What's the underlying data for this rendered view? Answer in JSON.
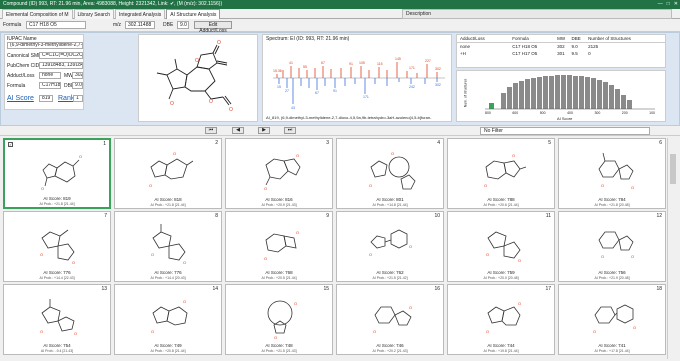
{
  "window": {
    "title": "Compound (ID) 993, RT: 21.96 min, Area: 4983088, Height: 2321342, Link: ✔, (M (m/z): 302.1156))"
  },
  "tabs": [
    {
      "label": "Elemental Composition of M"
    },
    {
      "label": "Library Search"
    },
    {
      "label": "Integrated Analysis"
    },
    {
      "label": "AI Structure Analysis"
    }
  ],
  "description_tab": "Description",
  "formula_bar": {
    "formula_label": "Formula",
    "formula": "C17 H18 O5",
    "mz_label": "m/z",
    "mz": "302.11488",
    "dbe_label": "DBE",
    "dbe": "9.0",
    "edit_button": "Edit Adduct/Loss"
  },
  "details": {
    "iupac_label": "IUPAC Name",
    "iupac": "(6,9-dimethyl-3-methylidene-2,7-dioxo-4,5,9a,9b-tetrahydro-3aH-az",
    "smiles_label": "Canonical SMILES",
    "smiles": "C=C1C(=O)OC2C3C(C)=CC(=O)C3(C)C(OC(C)=O)CC12",
    "pubchem_label": "PubChem CID",
    "pubchem": "13918483, 13918484",
    "adduct_label": "Adduct/Loss",
    "adduct": "none",
    "mw_label": "MW",
    "mw": "302",
    "formula_label": "Formula",
    "formula": "C17H18O5",
    "dbe_label": "DBE",
    "dbe": "9.0",
    "ai_score_label": "AI Score",
    "ai_score": "819",
    "rank_label": "Rank",
    "rank": "1"
  },
  "spectrum": {
    "title": "Spectrum: EI (ID: 993, RT: 21.96 min)",
    "caption": "AI_819, (6,9-dimethyl-3-methylidene-2,7-dioxo-4,5,9a,9b-tetrahydro-3aH-azuleno[4,5-b]furan-",
    "top_labels": [
      "15.36",
      "41",
      "55",
      "67",
      "77",
      "91",
      "105",
      "115",
      "130",
      "145",
      "159",
      "171",
      "189",
      "199",
      "214",
      "227",
      "242",
      "260",
      "284",
      "302"
    ],
    "bottom_labels": [
      "15",
      "27",
      "41",
      "43",
      "55",
      "67",
      "77",
      "91",
      "105",
      "115",
      "128",
      "145",
      "171",
      "187",
      "199",
      "242",
      "284",
      "302"
    ],
    "bottom_peak": "43"
  },
  "adduct_table": {
    "headers": [
      "Adduct/Loss",
      "Formula",
      "MW",
      "DBE",
      "Number of Structures"
    ],
    "rows": [
      [
        "none",
        "C17 H18 O5",
        "302",
        "9.0",
        "2125"
      ],
      [
        "+H",
        "C17 H17 O5",
        "301",
        "9.5",
        "0"
      ]
    ]
  },
  "histogram": {
    "ylabel": "Num. of structures",
    "xlabel": "AI Score",
    "ticks": [
      "800",
      "600",
      "500",
      "400",
      "300",
      "200",
      "100"
    ],
    "accent": "#3aa35b"
  },
  "navigator": {
    "first": "⏮",
    "prev": "◀",
    "next": "▶",
    "last": "⏭",
    "filter": "No Filter"
  },
  "candidates": [
    {
      "num": "1",
      "score": "AI Score: 819",
      "prob": "AI Prob.: +21.8 [21.44]"
    },
    {
      "num": "2",
      "score": "AI Score: 818",
      "prob": "AI Prob.: +21.8 [21.44]"
    },
    {
      "num": "3",
      "score": "AI Score: 816",
      "prob": "AI Prob.: +20.9 [21.43]"
    },
    {
      "num": "4",
      "score": "AI Score: 801",
      "prob": "AI Prob.: +14.8 [21.44]"
    },
    {
      "num": "5",
      "score": "AI Score: 788",
      "prob": "AI Prob.: +20.6 [21.44]"
    },
    {
      "num": "6",
      "score": "AI Score: 784",
      "prob": "AI Prob.: +21.8 [20.48]"
    },
    {
      "num": "7",
      "score": "AI Score: 776",
      "prob": "AI Prob.: +14.4 [22.43]"
    },
    {
      "num": "8",
      "score": "AI Score: 776",
      "prob": "AI Prob.: +14.4 [20.43]"
    },
    {
      "num": "9",
      "score": "AI Score: 768",
      "prob": "AI Prob.: +20.5 [21.44]"
    },
    {
      "num": "10",
      "score": "AI Score: 762",
      "prob": "AI Prob.: +21.5 [21.42]"
    },
    {
      "num": "11",
      "score": "AI Score: 759",
      "prob": "AI Prob.: +20.0 [20.48]"
    },
    {
      "num": "12",
      "score": "AI Score: 756",
      "prob": "AI Prob.: +21.9 [20.48]"
    },
    {
      "num": "13",
      "score": "AI Score: 754",
      "prob": "AI Prob.: -9.4 [21.43]"
    },
    {
      "num": "14",
      "score": "AI Score: 749",
      "prob": "AI Prob.: +20.8 [21.44]"
    },
    {
      "num": "15",
      "score": "AI Score: 748",
      "prob": "AI Prob.: +21.5 [21.43]"
    },
    {
      "num": "16",
      "score": "AI Score: 746",
      "prob": "AI Prob.: +20.2 [21.43]"
    },
    {
      "num": "17",
      "score": "AI Score: 744",
      "prob": "AI Prob.: +19.8 [21.44]"
    },
    {
      "num": "18",
      "score": "AI Score: 741",
      "prob": "AI Prob.: +17.8 [21.44]"
    }
  ]
}
